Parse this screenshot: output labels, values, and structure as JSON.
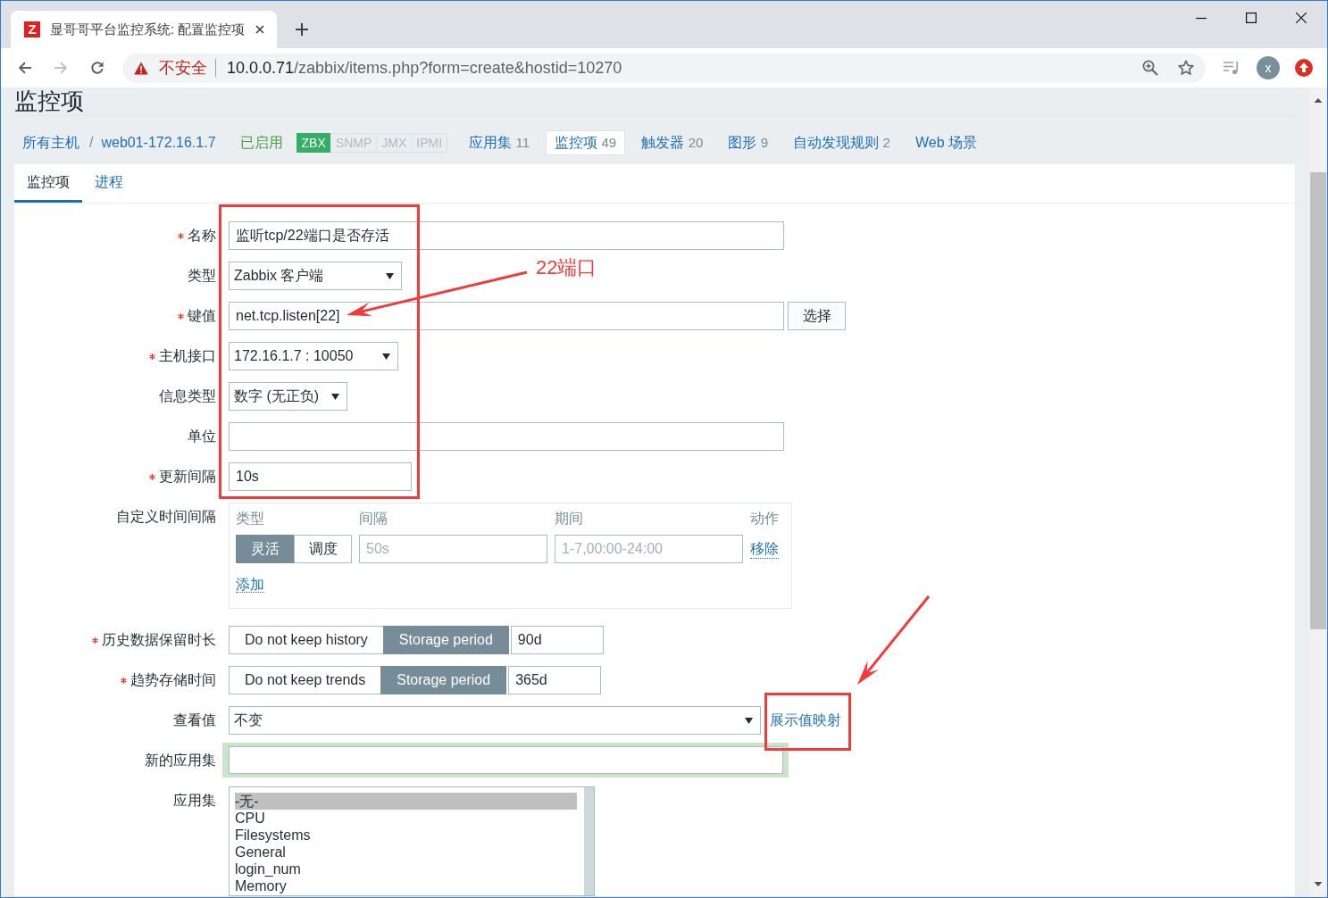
{
  "browser": {
    "tab": {
      "favicon": "Z",
      "title": "显哥哥平台监控系统: 配置监控项"
    },
    "address_bar": {
      "security": "不安全",
      "host": "10.0.0.71",
      "path": "/zabbix/items.php?form=create&hostid=10270"
    },
    "profile": "x"
  },
  "page_title": "监控项",
  "breadcrumb": {
    "items": [
      "所有主机",
      "web01-172.16.1.7"
    ],
    "separator": "/"
  },
  "status": "已启用",
  "availability": [
    {
      "label": "ZBX",
      "on": true
    },
    {
      "label": "SNMP",
      "on": false
    },
    {
      "label": "JMX",
      "on": false
    },
    {
      "label": "IPMI",
      "on": false
    }
  ],
  "host_nav": [
    {
      "label": "应用集",
      "count": "11",
      "selected": false
    },
    {
      "label": "监控项",
      "count": "49",
      "selected": true
    },
    {
      "label": "触发器",
      "count": "20",
      "selected": false
    },
    {
      "label": "图形",
      "count": "9",
      "selected": false
    },
    {
      "label": "自动发现规则",
      "count": "2",
      "selected": false
    },
    {
      "label": "Web 场景",
      "selected": false
    }
  ],
  "form_tabs": [
    {
      "label": "监控项",
      "selected": true
    },
    {
      "label": "进程",
      "selected": false
    }
  ],
  "fields": [
    {
      "kind": "text",
      "label": "名称",
      "required": true,
      "value": "监听tcp/22端口是否存活",
      "focused": false
    },
    {
      "kind": "select",
      "label": "类型",
      "required": false,
      "value": "Zabbix 客户端"
    },
    {
      "kind": "text",
      "label": "键值",
      "required": true,
      "value": "net.tcp.listen[22]",
      "focused": false,
      "button": "选择"
    },
    {
      "kind": "select",
      "label": "主机接口",
      "required": true,
      "value": "172.16.1.7 : 10050"
    },
    {
      "kind": "select",
      "label": "信息类型",
      "required": false,
      "value": "数字 (无正负)"
    },
    {
      "kind": "text",
      "label": "单位",
      "required": false,
      "focused": false
    },
    {
      "kind": "text",
      "label": "更新间隔",
      "required": true,
      "value": "10s",
      "focused": false
    },
    {
      "kind": "intervals",
      "label": "自定义时间间隔",
      "required": false,
      "columns": [
        "类型",
        "间隔",
        "期间",
        "动作"
      ],
      "rows": [
        {
          "modes": [
            {
              "label": "灵活",
              "selected": true
            },
            {
              "label": "调度",
              "selected": false
            }
          ],
          "interval_placeholder": "50s",
          "period_placeholder": "1-7,00:00-24:00",
          "action": "移除"
        }
      ],
      "add": "添加"
    },
    {
      "kind": "storage",
      "label": "历史数据保留时长",
      "required": true,
      "options": [
        {
          "label": "Do not keep history",
          "selected": false
        },
        {
          "label": "Storage period",
          "selected": true
        }
      ],
      "value": "90d"
    },
    {
      "kind": "storage",
      "label": "趋势存储时间",
      "required": true,
      "options": [
        {
          "label": "Do not keep trends",
          "selected": false
        },
        {
          "label": "Storage period",
          "selected": true
        }
      ],
      "value": "365d"
    },
    {
      "kind": "select",
      "label": "查看值",
      "required": false,
      "value": "不变",
      "link": "展示值映射"
    },
    {
      "kind": "text",
      "label": "新的应用集",
      "required": false,
      "focused": true
    },
    {
      "kind": "listbox",
      "label": "应用集",
      "required": false,
      "options": [
        {
          "label": "-无-",
          "selected": true
        },
        {
          "label": "CPU",
          "selected": false
        },
        {
          "label": "Filesystems",
          "selected": false
        },
        {
          "label": "General",
          "selected": false
        },
        {
          "label": "login_num",
          "selected": false
        },
        {
          "label": "Memory",
          "selected": false
        }
      ]
    }
  ],
  "annotations": [
    {
      "kind": "box"
    },
    {
      "kind": "arrow"
    },
    {
      "kind": "text",
      "text": "22端口"
    },
    {
      "kind": "arrow"
    },
    {
      "kind": "box"
    }
  ]
}
